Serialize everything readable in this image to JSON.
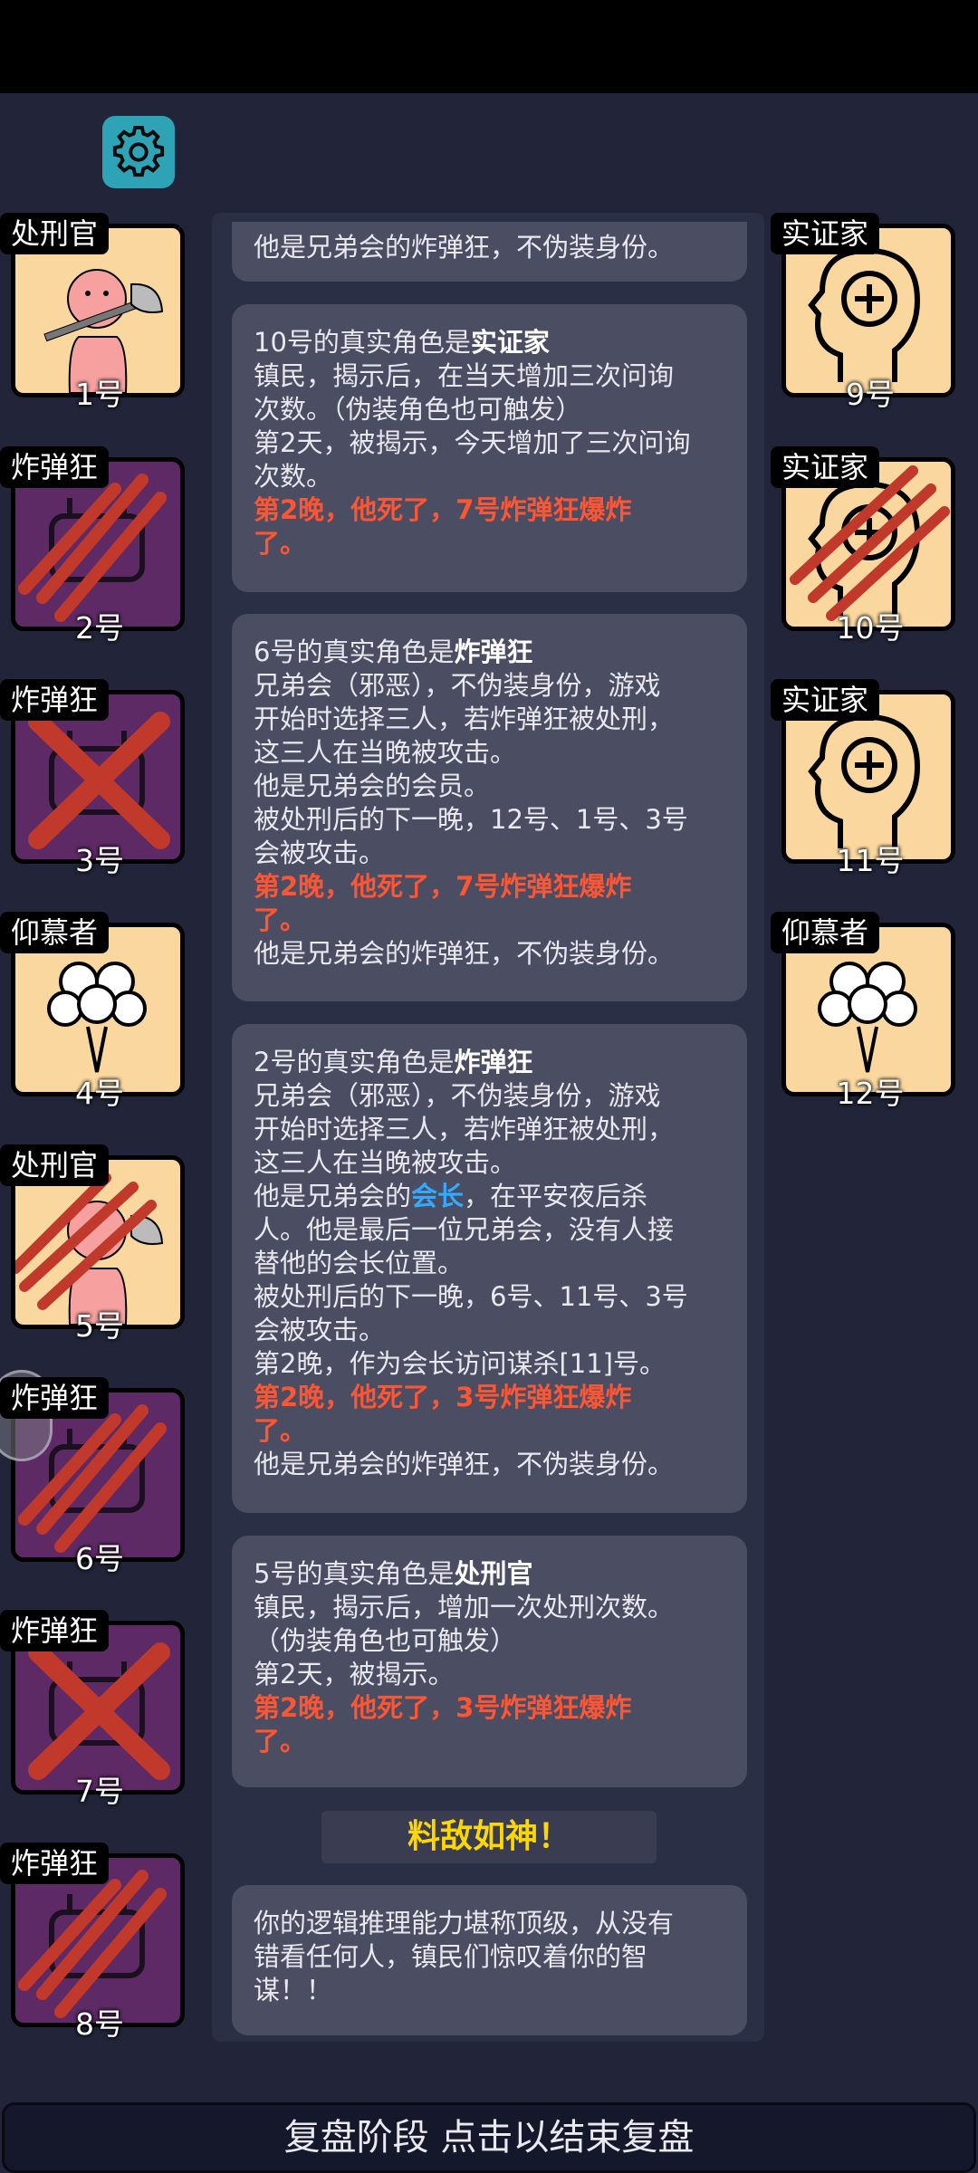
{
  "left_cards": [
    {
      "role": "处刑官",
      "num": "1号"
    },
    {
      "role": "炸弹狂",
      "num": "2号"
    },
    {
      "role": "炸弹狂",
      "num": "3号"
    },
    {
      "role": "仰慕者",
      "num": "4号"
    },
    {
      "role": "处刑官",
      "num": "5号"
    },
    {
      "role": "炸弹狂",
      "num": "6号"
    },
    {
      "role": "炸弹狂",
      "num": "7号"
    },
    {
      "role": "炸弹狂",
      "num": "8号"
    }
  ],
  "right_cards": [
    {
      "role": "实证家",
      "num": "9号"
    },
    {
      "role": "实证家",
      "num": "10号"
    },
    {
      "role": "实证家",
      "num": "11号"
    },
    {
      "role": "仰慕者",
      "num": "12号"
    }
  ],
  "messages": {
    "m0": {
      "l1": "他是兄弟会的炸弹狂，不伪装身份。"
    },
    "m1": {
      "pre": "10号的真实角色是",
      "role": "实证家",
      "l2": "镇民，揭示后，在当天增加三次问询",
      "l3": "次数。（伪装角色也可触发）",
      "l4": "第2天，被揭示，今天增加了三次问询",
      "l5": "次数。",
      "r1": "第2晚，他死了，7号炸弹狂爆炸",
      "r2": "了。"
    },
    "m2": {
      "pre": "6号的真实角色是",
      "role": "炸弹狂",
      "l2": "兄弟会（邪恶），不伪装身份，游戏",
      "l3": "开始时选择三人，若炸弹狂被处刑，",
      "l4": "这三人在当晚被攻击。",
      "l5": "他是兄弟会的会员。",
      "l6": "被处刑后的下一晚，12号、1号、3号",
      "l7": "会被攻击。",
      "r1": "第2晚，他死了，7号炸弹狂爆炸",
      "r2": "了。",
      "l8": "他是兄弟会的炸弹狂，不伪装身份。"
    },
    "m3": {
      "pre": "2号的真实角色是",
      "role": "炸弹狂",
      "l2": "兄弟会（邪恶），不伪装身份，游戏",
      "l3": "开始时选择三人，若炸弹狂被处刑，",
      "l4": "这三人在当晚被攻击。",
      "l5a": "他是兄弟会的",
      "l5b": "会长",
      "l5c": "，在平安夜后杀",
      "l6": "人。他是最后一位兄弟会，没有人接",
      "l7": "替他的会长位置。",
      "l8": "被处刑后的下一晚，6号、11号、3号",
      "l9": "会被攻击。",
      "l10": "第2晚，作为会长访问谋杀[11]号。",
      "r1": "第2晚，他死了，3号炸弹狂爆炸",
      "r2": "了。",
      "l11": "他是兄弟会的炸弹狂，不伪装身份。"
    },
    "m4": {
      "pre": "5号的真实角色是",
      "role": "处刑官",
      "l2": "镇民，揭示后，增加一次处刑次数。",
      "l3": "（伪装角色也可触发）",
      "l4": "第2天，被揭示。",
      "r1": "第2晚，他死了，3号炸弹狂爆炸",
      "r2": "了。"
    },
    "m5": {
      "l1": "你的逻辑推理能力堪称顶级，从没有",
      "l2": "错看任何人，镇民们惊叹着你的智",
      "l3": "谋！！"
    }
  },
  "banner": "料敌如神！",
  "bottom_bar": "复盘阶段 点击以结束复盘",
  "icons": {
    "settings": "gear-icon"
  },
  "colors": {
    "accent_red": "#ff5533",
    "accent_blue": "#33aaff",
    "banner_gold": "#ffd700",
    "card_light": "#f9d79e",
    "card_purple": "#5e2a66"
  }
}
